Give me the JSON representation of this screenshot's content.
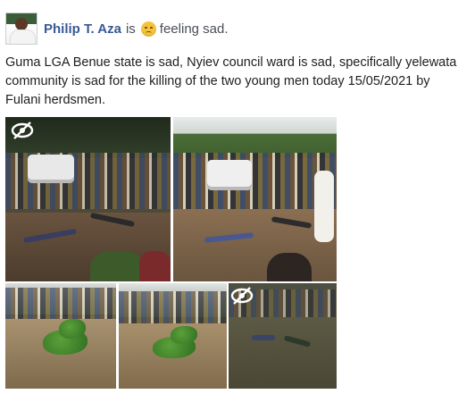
{
  "post": {
    "author": "Philip T. Aza",
    "is_word": "is",
    "feeling": "feeling sad.",
    "feeling_icon": "sad-face-emoji-icon",
    "text": "Guma LGA Benue state is sad, Nyiev council ward is sad, specifically yelewata community is sad for the killing of the two young men today 15/05/2021 by Fulani herdsmen."
  },
  "photos": [
    {
      "id": "photo-1",
      "sensitive_icon": "eye-crossed-icon"
    },
    {
      "id": "photo-2"
    },
    {
      "id": "photo-3"
    },
    {
      "id": "photo-4"
    },
    {
      "id": "photo-5",
      "sensitive_icon": "eye-crossed-icon"
    }
  ],
  "colors": {
    "author_link": "#385898",
    "text": "#1c1e21",
    "muted": "#4b4f56"
  }
}
